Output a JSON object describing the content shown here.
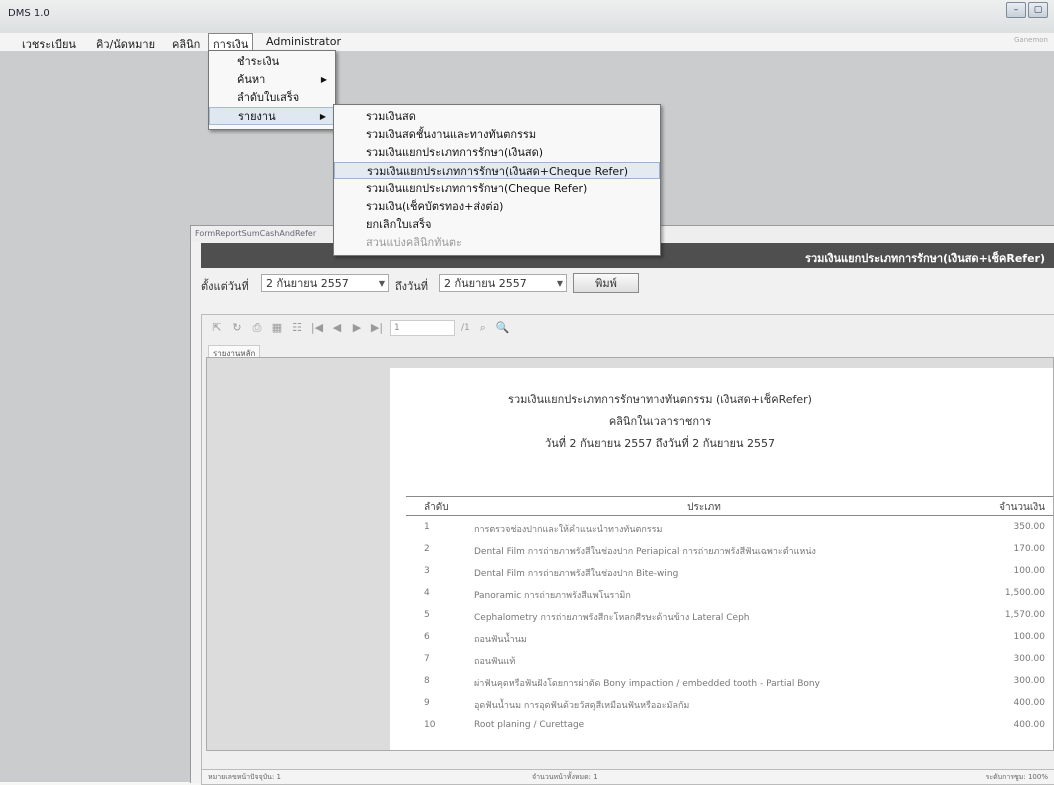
{
  "window": {
    "title": "DMS 1.0",
    "controls": [
      "–",
      "▢"
    ],
    "user": "Ganemon"
  },
  "menubar": {
    "items": [
      "เวชระเบียน",
      "คิว/นัดหมาย",
      "คลินิก",
      "การเงิน",
      "Administrator"
    ]
  },
  "finance_menu": {
    "items": [
      {
        "label": "ชำระเงิน",
        "submenu": false
      },
      {
        "label": "ค้นหา",
        "submenu": true
      },
      {
        "label": "ลำดับใบเสร็จ",
        "submenu": false
      },
      {
        "label": "รายงาน",
        "submenu": true
      }
    ]
  },
  "report_menu": {
    "items": [
      "รวมเงินสด",
      "รวมเงินสดชั้นงานและทางทันตกรรม",
      "รวมเงินแยกประเภทการรักษา(เงินสด)",
      "รวมเงินแยกประเภทการรักษา(เงินสด+Cheque Refer)",
      "รวมเงินแยกประเภทการรักษา(Cheque Refer)",
      "รวมเงิน(เช็คบัตรทอง+ส่งต่อ)",
      "ยกเลิกใบเสร็จ",
      "สวนแบ่งคลินิกทันตะ"
    ],
    "highlighted_index": 3
  },
  "form": {
    "title": "FormReportSumCashAndRefer",
    "header_title": "รวมเงินแยกประเภทการรักษา(เงินสด+เช็คRefer)",
    "from_label": "ตั้งแต่วันที่",
    "from_day": "2",
    "from_month": "กันยายน",
    "from_year": "2557",
    "to_label": "ถึงวันที่",
    "to_day": "2",
    "to_month": "กันยายน",
    "to_year": "2557",
    "print_button": "พิมพ์"
  },
  "viewer": {
    "page_input": "1",
    "page_total": "/1",
    "tab_label": "รายงานหลัก",
    "status_left": "หมายเลขหน้าปัจจุบัน: 1",
    "status_middle": "จำนวนหน้าทั้งหมด: 1",
    "status_right": "ระดับการซูม: 100%"
  },
  "report": {
    "title": "รวมเงินแยกประเภทการรักษาทางทันตกรรม (เงินสด+เช็คRefer)",
    "subtitle": "คลินิกในเวลาราชการ",
    "date_range": "วันที่ 2 กันยายน 2557 ถึงวันที่ 2 กันยายน 2557",
    "columns": [
      "ลำดับ",
      "ประเภท",
      "จำนวนเงิน"
    ],
    "rows": [
      {
        "no": "1",
        "type": "การตรวจช่องปากและให้คำแนะนำทางทันตกรรม",
        "amount": "350.00"
      },
      {
        "no": "2",
        "type": "Dental Film การถ่ายภาพรังสีในช่องปาก Periapical การถ่ายภาพรังสีฟันเฉพาะตำแหน่ง",
        "amount": "170.00"
      },
      {
        "no": "3",
        "type": "Dental Film การถ่ายภาพรังสีในช่องปาก Bite-wing",
        "amount": "100.00"
      },
      {
        "no": "4",
        "type": "Panoramic การถ่ายภาพรังสีแพโนรามิก",
        "amount": "1,500.00"
      },
      {
        "no": "5",
        "type": "Cephalometry การถ่ายภาพรังสีกะโหลกศีรษะด้านข้าง Lateral Ceph",
        "amount": "1,570.00"
      },
      {
        "no": "6",
        "type": "ถอนฟันน้ำนม",
        "amount": "100.00"
      },
      {
        "no": "7",
        "type": "ถอนฟันแท้",
        "amount": "300.00"
      },
      {
        "no": "8",
        "type": "ผ่าฟันคุดหรือฟันฝังโดยการผ่าตัด Bony impaction / embedded tooth - Partial Bony",
        "amount": "300.00"
      },
      {
        "no": "9",
        "type": "อุดฟันน้ำนม การอุดฟันด้วยวัสดุสีเหมือนฟันหรืออะมัลกัม",
        "amount": "400.00"
      },
      {
        "no": "10",
        "type": "Root planing / Curettage",
        "amount": "400.00"
      }
    ]
  }
}
